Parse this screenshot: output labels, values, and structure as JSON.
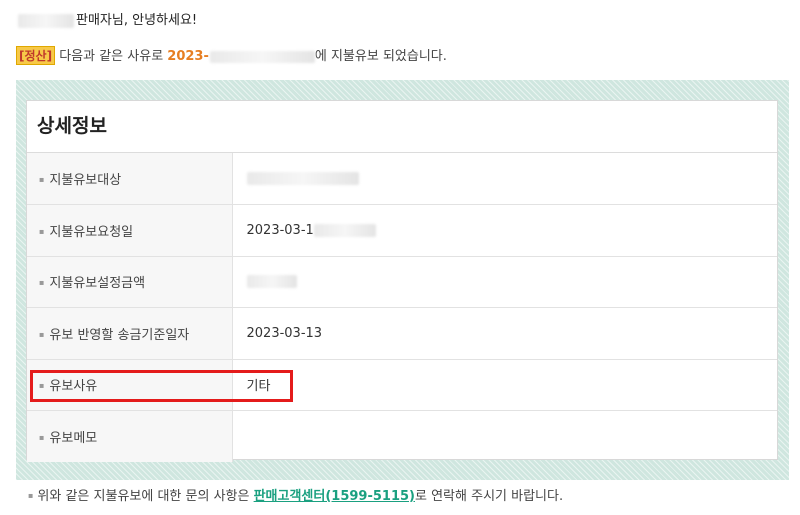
{
  "greeting": {
    "suffix": "판매자님, 안녕하세요!"
  },
  "notice": {
    "tag": "정산",
    "text_before": "다음과 같은 사유로",
    "date_prefix": "2023-",
    "text_after": "에 지불유보 되었습니다."
  },
  "details": {
    "title": "상세정보",
    "rows": [
      {
        "label": "지불유보대상",
        "value": ""
      },
      {
        "label": "지불유보요청일",
        "value": "2023-03-1"
      },
      {
        "label": "지불유보설정금액",
        "value": ""
      },
      {
        "label": "유보 반영할 송금기준일자",
        "value": "2023-03-13"
      },
      {
        "label": "유보사유",
        "value": "기타"
      },
      {
        "label": "유보메모",
        "value": ""
      }
    ]
  },
  "footer": {
    "text_before": "위와 같은 지불유보에 대한 문의 사항은",
    "link": "판매고객센터(1599-5115)",
    "text_after": "로 연락해 주시기 바랍니다."
  },
  "colors": {
    "accent_link": "#1aa080",
    "date_highlight": "#e67e22",
    "tag_bg": "#f7c948",
    "highlight_box": "#e41b1b"
  }
}
